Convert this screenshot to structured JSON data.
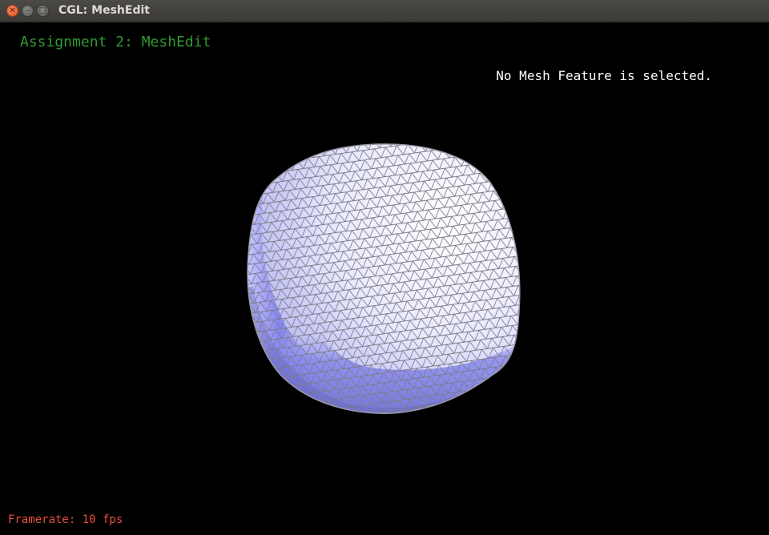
{
  "window": {
    "title": "CGL: MeshEdit",
    "controls": [
      "close-icon",
      "minimize-icon",
      "maximize-icon"
    ]
  },
  "overlay": {
    "assignment": "Assignment 2: MeshEdit",
    "selection_status": "No Mesh Feature is selected.",
    "framerate": "Framerate: 10 fps"
  },
  "colors": {
    "background": "#000000",
    "assignment_text": "#2f9a2f",
    "framerate_text": "#e84f3c",
    "mesh_light": "#f4f4ff",
    "mesh_shade": "#8080f5",
    "wireframe": "#7a7a85"
  }
}
